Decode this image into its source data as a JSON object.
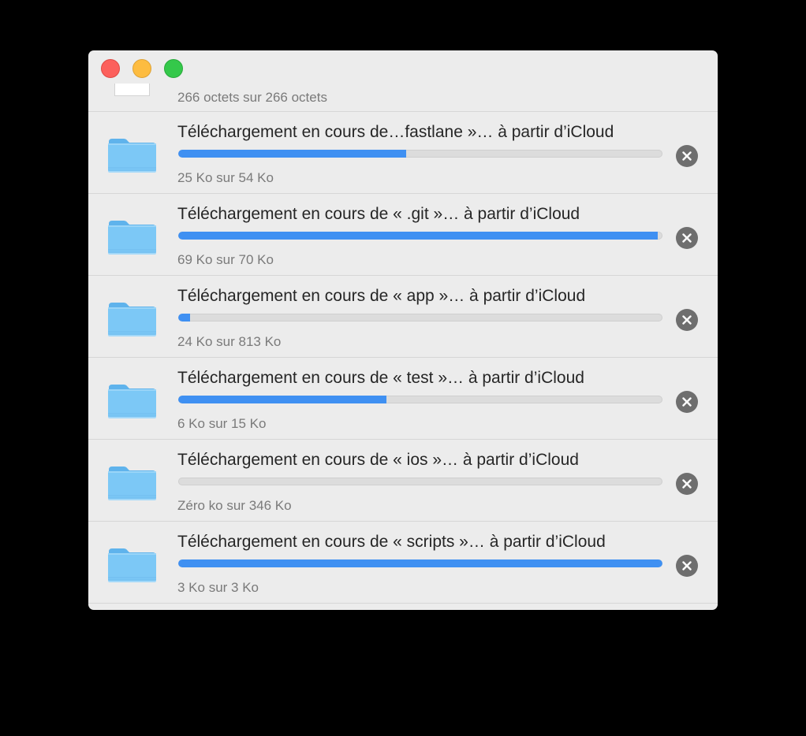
{
  "window": {
    "controls": [
      "close",
      "minimize",
      "zoom"
    ]
  },
  "top_item": {
    "status": "266 octets sur 266 octets"
  },
  "downloads": [
    {
      "title": "Téléchargement en cours de…fastlane »… à partir d’iCloud",
      "progress": 0.47,
      "status": "25 Ko sur 54 Ko",
      "icon": "folder-icon"
    },
    {
      "title": "Téléchargement en cours de « .git »… à partir d’iCloud",
      "progress": 0.99,
      "status": "69 Ko sur 70 Ko",
      "icon": "folder-icon"
    },
    {
      "title": "Téléchargement en cours de « app »… à partir d’iCloud",
      "progress": 0.025,
      "status": "24 Ko sur 813 Ko",
      "icon": "folder-icon"
    },
    {
      "title": "Téléchargement en cours de « test »… à partir d’iCloud",
      "progress": 0.43,
      "status": "6 Ko sur 15 Ko",
      "icon": "folder-icon"
    },
    {
      "title": "Téléchargement en cours de « ios »… à partir d’iCloud",
      "progress": 0.0,
      "status": "Zéro ko sur 346 Ko",
      "icon": "folder-icon"
    },
    {
      "title": "Téléchargement en cours de « scripts »… à partir d’iCloud",
      "progress": 1.0,
      "status": "3 Ko sur 3 Ko",
      "icon": "folder-icon"
    }
  ],
  "colors": {
    "progress_fill": "#3f90f2",
    "folder": "#7cc8f6",
    "cancel_button": "#6e6e6e"
  }
}
